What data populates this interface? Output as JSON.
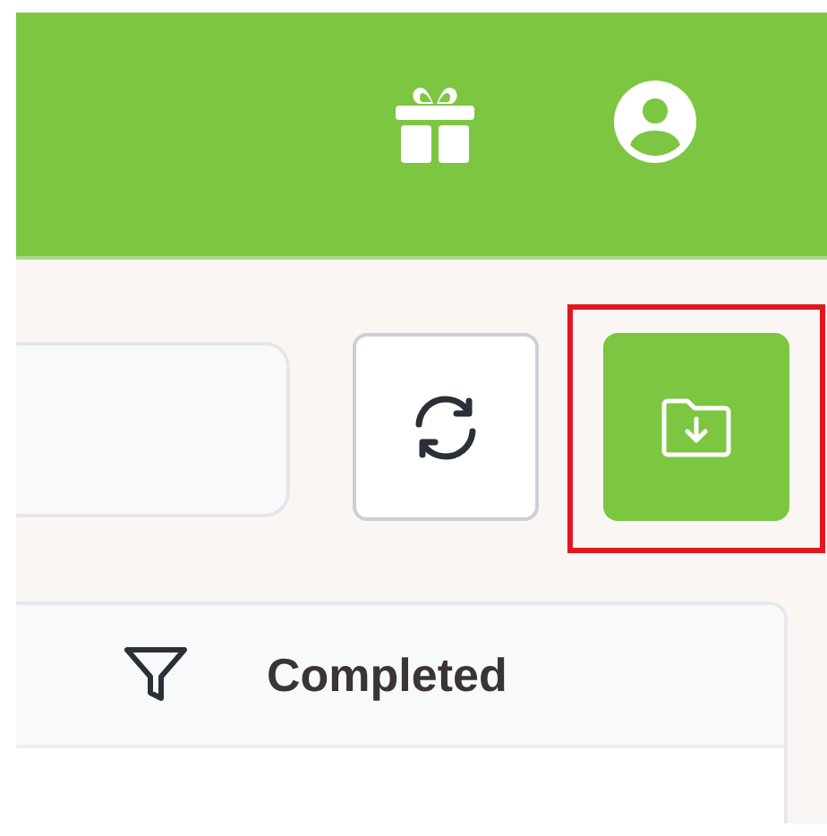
{
  "header": {
    "icons": [
      {
        "kind": "gift"
      },
      {
        "kind": "account"
      }
    ]
  },
  "toolbar": {
    "buttons": [
      {
        "kind": "refresh",
        "highlighted": false
      },
      {
        "kind": "export",
        "highlighted": true
      }
    ]
  },
  "table": {
    "columns": [
      {
        "label": "Completed",
        "filter": true
      }
    ]
  }
}
